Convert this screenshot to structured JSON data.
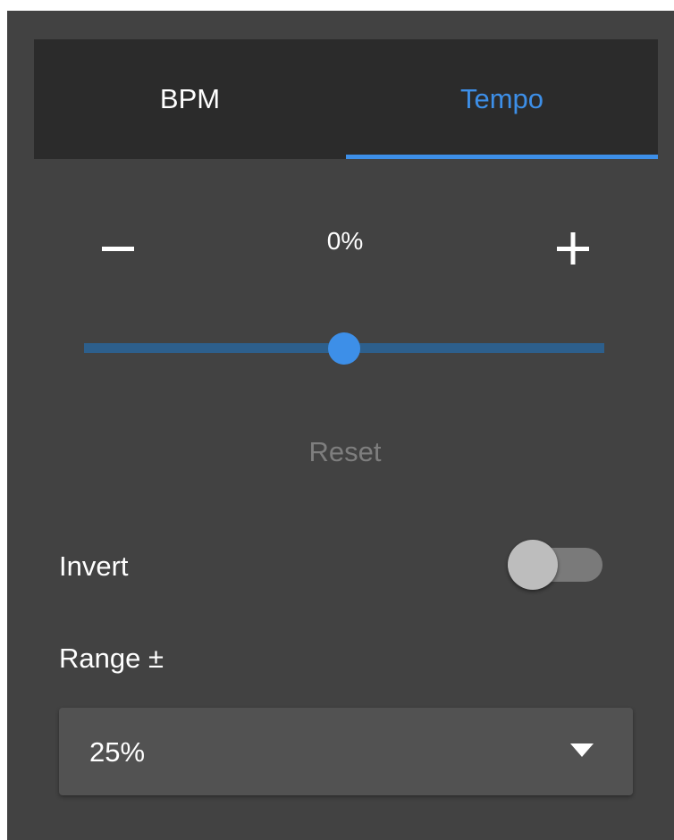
{
  "tabs": [
    {
      "label": "BPM",
      "active": false
    },
    {
      "label": "Tempo",
      "active": true
    }
  ],
  "tempo": {
    "value_text": "0%",
    "slider_fraction": 0.5,
    "decrease_icon": "minus-icon",
    "increase_icon": "plus-icon"
  },
  "reset_label": "Reset",
  "invert": {
    "label": "Invert",
    "enabled": false
  },
  "range": {
    "label": "Range ±",
    "selected": "25%",
    "icon": "caret-down-icon"
  },
  "colors": {
    "accent": "#3d8fe8",
    "panel_background": "#424242",
    "tab_bar_background": "#2b2b2b",
    "disabled_text": "#7e7e7e"
  }
}
